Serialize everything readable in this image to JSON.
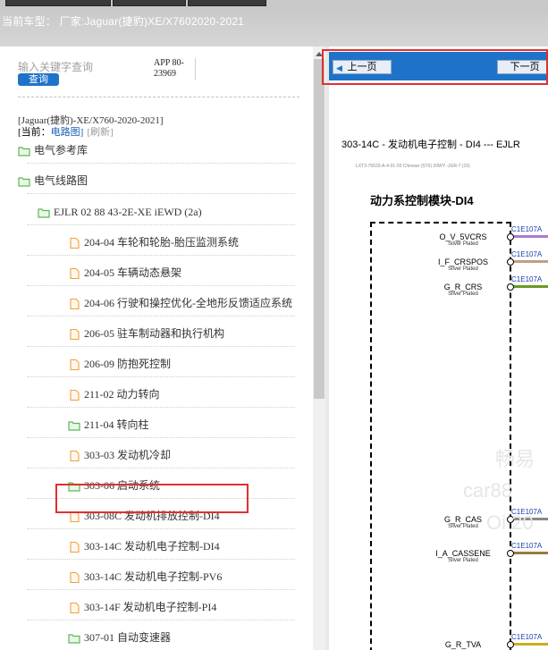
{
  "vehicle_label": "当前车型： 厂家:Jaguar(捷豹)XE/X7602020-2021",
  "search": {
    "placeholder": "输入关键字查询",
    "button": "查询"
  },
  "app_version": "APP 80-23969",
  "tree": {
    "vehicle_title": "[Jaguar(捷豹)-XE/X760-2020-2021]",
    "current_prefix": "[当前：",
    "current_link": "电路图]",
    "refresh": "[刷新]",
    "nodes": [
      {
        "label": "电气参考库",
        "type": "folder",
        "level": 0
      },
      {
        "label": "电气线路图",
        "type": "folder",
        "level": 0
      },
      {
        "label": "EJLR 02 88 43-2E-XE iEWD (2a)",
        "type": "folder",
        "level": 1
      },
      {
        "label": "204-04 车轮和轮胎-胎压监测系统",
        "type": "file",
        "level": 2
      },
      {
        "label": "204-05 车辆动态悬架",
        "type": "file",
        "level": 2
      },
      {
        "label": "204-06 行驶和操控优化-全地形反馈适应系统",
        "type": "file",
        "level": 2
      },
      {
        "label": "206-05 驻车制动器和执行机构",
        "type": "file",
        "level": 2
      },
      {
        "label": "206-09 防抱死控制",
        "type": "file",
        "level": 2
      },
      {
        "label": "211-02 动力转向",
        "type": "file",
        "level": 2
      },
      {
        "label": "211-04 转向柱",
        "type": "folder",
        "level": 2
      },
      {
        "label": "303-03 发动机冷却",
        "type": "file",
        "level": 2
      },
      {
        "label": "303-06 启动系统",
        "type": "folder",
        "level": 2
      },
      {
        "label": "303-08C 发动机排放控制-DI4",
        "type": "file",
        "level": 2
      },
      {
        "label": "303-14C 发动机电子控制-DI4",
        "type": "file",
        "level": 2,
        "selected": true
      },
      {
        "label": "303-14C 发动机电子控制-PV6",
        "type": "file",
        "level": 2
      },
      {
        "label": "303-14F 发动机电子控制-PI4",
        "type": "file",
        "level": 2
      },
      {
        "label": "307-01 自动变速器",
        "type": "folder",
        "level": 2
      }
    ]
  },
  "viewer": {
    "prev_button": "上一页",
    "next_button": "下一页",
    "doc_title": "303-14C - 发动机电子控制 - DI4 --- EJLR",
    "doc_subtitle": "LXT3-75633-A-4-01-03 Chinese (ST6) 20WY -JGR-7 (19)",
    "module_title": "动力系控制模块-DI4",
    "pins": [
      {
        "name": "O_V_5VCRS",
        "sub": "Silver Plated",
        "wire": "C1E107A",
        "color": "#b07ac8"
      },
      {
        "name": "I_F_CRSPOS",
        "sub": "Silver Plated",
        "wire": "C1E107A",
        "color": "#c0a080"
      },
      {
        "name": "G_R_CRS",
        "sub": "Silver Plated",
        "wire": "C1E107A",
        "color": "#6a9a20"
      },
      {
        "name": "G_R_CAS",
        "sub": "Silver Plated",
        "wire": "C1E107A",
        "color": "#8a8a8a"
      },
      {
        "name": "I_A_CASSENE",
        "sub": "Silver Plated",
        "wire": "C1E107A",
        "color": "#9a7a40"
      },
      {
        "name": "G_R_TVA",
        "sub": "",
        "wire": "C1E107A",
        "color": "#c8b020"
      }
    ],
    "watermark": [
      "畅易",
      "car88",
      "Oi 20"
    ]
  },
  "colors": {
    "accent": "#1e73c8",
    "highlight": "#e03030",
    "folder": "#5cb85c",
    "file": "#f0a040"
  }
}
